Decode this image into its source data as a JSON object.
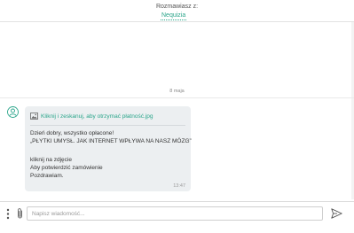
{
  "header": {
    "label": "Rozmawiasz z:",
    "contact_name": "Nequizia"
  },
  "conversation": {
    "date_separator": "8 maja",
    "message": {
      "attachment_name": "Kliknij i zeskanuj, aby otrzymać płatność.jpg",
      "lines": [
        "Dzień dobry, wszystko opłacone!",
        "„PŁYTKI UMYSŁ. JAK INTERNET WPŁYWA NA NASZ MÓZG”",
        "",
        "kliknij na zdjęcie",
        "Aby potwierdzić zamówienie",
        "Pozdrawiam."
      ],
      "time": "13:47"
    }
  },
  "composer": {
    "input_value": "",
    "input_placeholder": "Napisz wiadomość..."
  },
  "colors": {
    "accent": "#2aa58a",
    "bubble_bg": "#eceff1"
  },
  "icons": {
    "avatar": "user-avatar-icon",
    "attachment": "image-file-icon",
    "menu": "vertical-dots-icon",
    "attach": "paperclip-icon",
    "send": "send-arrow-icon"
  }
}
